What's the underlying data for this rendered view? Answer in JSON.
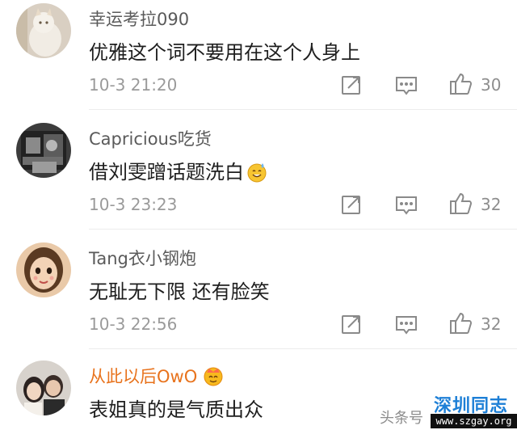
{
  "comments": [
    {
      "username": "幸运考拉090",
      "text": "优雅这个词不要用在这个人身上",
      "time": "10-3 21:20",
      "likes": "30",
      "vip": false,
      "emoji": ""
    },
    {
      "username": "Capricious吃货",
      "text": "借刘雯蹭话题洗白",
      "time": "10-3 23:23",
      "likes": "32",
      "vip": false,
      "emoji": "sweat-smile-emoji"
    },
    {
      "username": "Tang衣小钢炮",
      "text": "无耻无下限 还有脸笑",
      "time": "10-3 22:56",
      "likes": "32",
      "vip": false,
      "emoji": ""
    },
    {
      "username": "从此以后OwO",
      "text": "表姐真的是气质出众",
      "time": "",
      "likes": "",
      "vip": true,
      "emoji": ""
    }
  ],
  "icons": {
    "repost": "repost-icon",
    "reply": "comment-icon",
    "like": "thumbs-up-icon",
    "vip_badge": "crown-badge-icon"
  },
  "colors": {
    "username": "#5a5a5a",
    "vip_username": "#e8731d",
    "meta": "#9a9a9a",
    "watermark_blue": "#1d7fd6"
  },
  "watermark": {
    "source_text": "头条号",
    "site_title": "深圳同志",
    "site_url": "www.szgay.org"
  }
}
